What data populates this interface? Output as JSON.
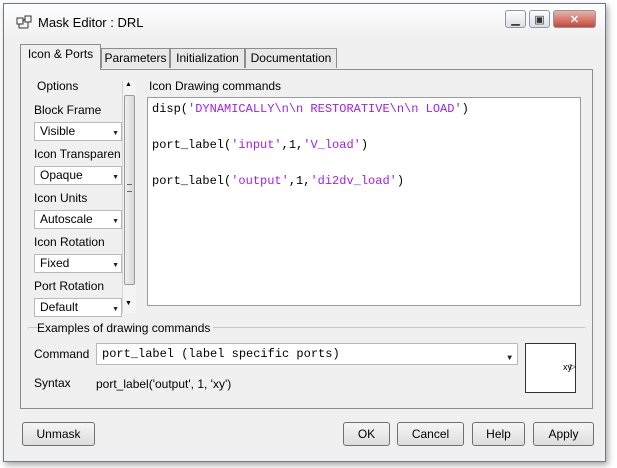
{
  "window": {
    "title": "Mask Editor : DRL"
  },
  "tabs": [
    {
      "label": "Icon & Ports"
    },
    {
      "label": "Parameters"
    },
    {
      "label": "Initialization"
    },
    {
      "label": "Documentation"
    }
  ],
  "options": {
    "title": "Options",
    "block_frame": {
      "label": "Block Frame",
      "value": "Visible"
    },
    "icon_transparency": {
      "label": "Icon Transparen",
      "value": "Opaque"
    },
    "icon_units": {
      "label": "Icon Units",
      "value": "Autoscale"
    },
    "icon_rotation": {
      "label": "Icon Rotation",
      "value": "Fixed"
    },
    "port_rotation": {
      "label": "Port Rotation",
      "value": "Default"
    }
  },
  "drawing": {
    "title": "Icon Drawing commands",
    "line1": {
      "fn": "disp(",
      "arg": "'DYNAMICALLY\\n\\n RESTORATIVE\\n\\n LOAD'",
      "end": ")"
    },
    "line2": {
      "fn": "port_label(",
      "a1": "'input'",
      "mid": ",1,",
      "a2": "'V_load'",
      "end": ")"
    },
    "line3": {
      "fn": "port_label(",
      "a1": "'output'",
      "mid": ",1,",
      "a2": "'di2dv_load'",
      "end": ")"
    }
  },
  "examples": {
    "title": "Examples of drawing commands",
    "command_label": "Command",
    "command_value": "port_label (label specific ports)",
    "syntax_label": "Syntax",
    "syntax_value": "port_label('output', 1, 'xy')",
    "preview_text": "xy"
  },
  "buttons": {
    "unmask": "Unmask",
    "ok": "OK",
    "cancel": "Cancel",
    "help": "Help",
    "apply": "Apply"
  }
}
